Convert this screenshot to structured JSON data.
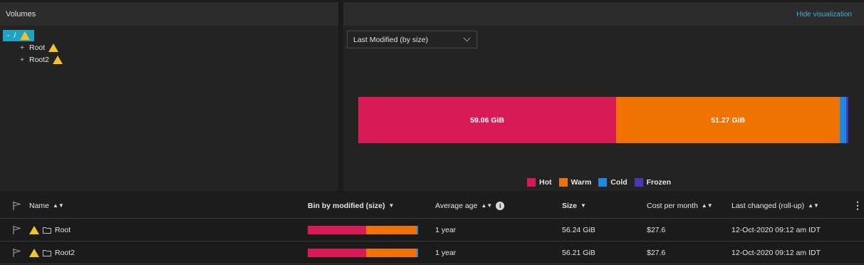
{
  "volumes_panel": {
    "title": "Volumes",
    "root_label": "/",
    "items": [
      {
        "label": "Root"
      },
      {
        "label": "Root2"
      }
    ]
  },
  "viz_panel": {
    "hide_label": "Hide visualization",
    "select_value": "Last Modified (by size)"
  },
  "chart_data": {
    "type": "bar",
    "orientation": "horizontal-stacked",
    "unit": "GiB",
    "series": [
      {
        "name": "Hot",
        "value": 59.06,
        "label": "59.06 GiB",
        "color": "#d81b56"
      },
      {
        "name": "Warm",
        "value": 51.27,
        "label": "51.27 GiB",
        "color": "#f07200"
      },
      {
        "name": "Cold",
        "value": 1.4,
        "label": "",
        "color": "#1e88e5"
      },
      {
        "name": "Frozen",
        "value": 0.5,
        "label": "",
        "color": "#4a36b8"
      }
    ]
  },
  "table": {
    "headers": {
      "name": "Name",
      "bin": "Bin by modified (size)",
      "avg_age": "Average age",
      "size": "Size",
      "cost": "Cost per month",
      "changed": "Last changed (roll-up)"
    },
    "rows": [
      {
        "name": "Root",
        "avg_age": "1 year",
        "size": "56.24 GiB",
        "cost": "$27.6",
        "changed": "12-Oct-2020 09:12 am IDT",
        "bin": {
          "hot": 0.53,
          "warm": 0.46,
          "cold": 0.01
        }
      },
      {
        "name": "Root2",
        "avg_age": "1 year",
        "size": "56.21 GiB",
        "cost": "$27.6",
        "changed": "12-Oct-2020 09:12 am IDT",
        "bin": {
          "hot": 0.53,
          "warm": 0.46,
          "cold": 0.01
        }
      }
    ]
  }
}
